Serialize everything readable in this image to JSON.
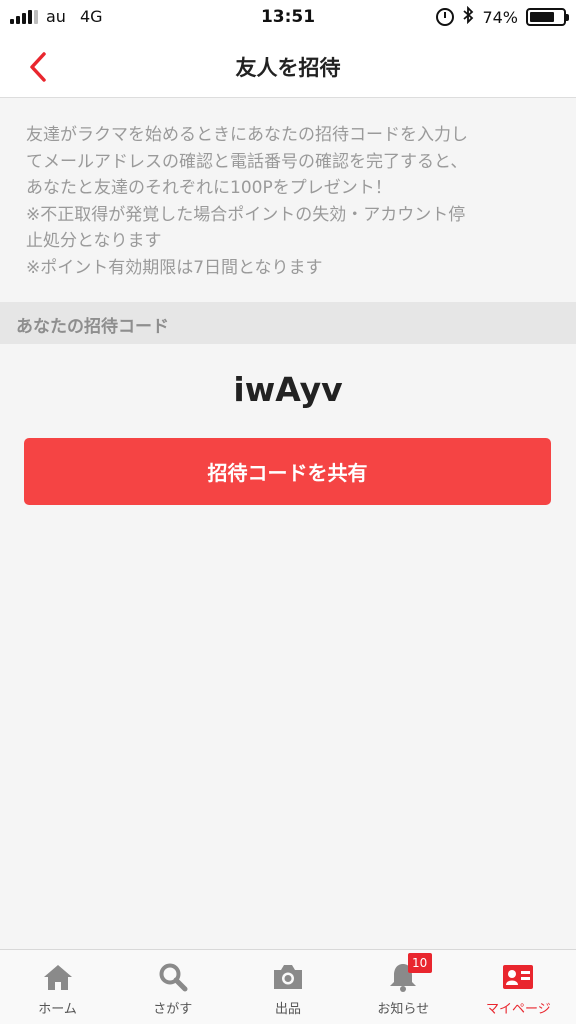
{
  "status_bar": {
    "carrier": "au",
    "network": "4G",
    "time": "13:51",
    "battery_percent": "74%",
    "battery_level": 0.74,
    "icons": [
      "signal-icon",
      "alarm-icon",
      "bluetooth-icon",
      "battery-icon"
    ]
  },
  "navbar": {
    "title": "友人を招待",
    "back_icon": "chevron-left-icon",
    "accent_color": "#e9262e"
  },
  "description": {
    "lines": [
      "友達がラクマを始めるときにあなたの招待コードを入力し",
      "てメールアドレスの確認と電話番号の確認を完了すると、",
      "あなたと友達のそれぞれに100Pをプレゼント！",
      "※不正取得が発覚した場合ポイントの失効・アカウント停",
      "止処分となります",
      "※ポイント有効期限は7日間となります"
    ]
  },
  "invite": {
    "section_label": "あなたの招待コード",
    "code": "iwAyv",
    "share_button_label": "招待コードを共有",
    "button_color": "#f54444"
  },
  "tabbar": {
    "items": [
      {
        "label": "ホーム",
        "icon": "home-icon",
        "active": false
      },
      {
        "label": "さがす",
        "icon": "search-icon",
        "active": false
      },
      {
        "label": "出品",
        "icon": "camera-icon",
        "active": false
      },
      {
        "label": "お知らせ",
        "icon": "bell-icon",
        "active": false,
        "badge": "10"
      },
      {
        "label": "マイページ",
        "icon": "profile-card-icon",
        "active": true
      }
    ]
  }
}
